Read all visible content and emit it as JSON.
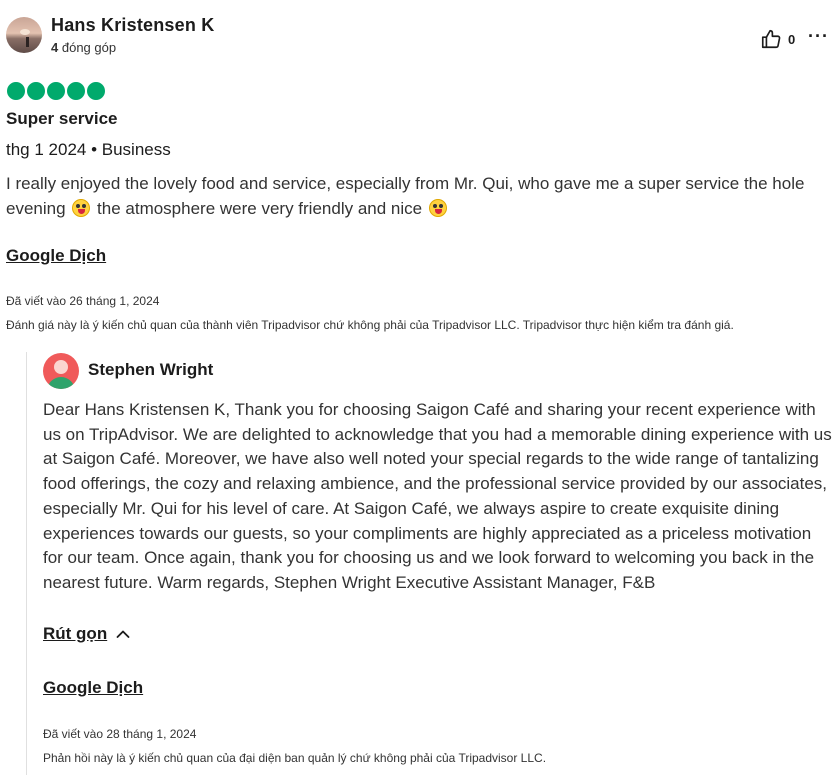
{
  "review": {
    "author_name": "Hans Kristensen K",
    "contributions_count": "4",
    "contributions_label": "đóng góp",
    "helpful_count": "0",
    "more_label": "···",
    "rating": 5,
    "rating_color": "#00aa6c",
    "title": "Super service",
    "visit_meta": "thg 1 2024 • Business",
    "body_part1": "I really enjoyed the lovely food and service, especially from Mr. Qui, who gave me a super service the hole evening",
    "body_part2": "the atmosphere were very friendly and nice",
    "emoji": "grinning-face-emoji",
    "translate_label": "Google Dịch",
    "written_date": "Đã viết vào 26 tháng 1, 2024",
    "disclaimer": "Đánh giá này là ý kiến chủ quan của thành viên Tripadvisor chứ không phải của Tripadvisor LLC. Tripadvisor thực hiện kiểm tra đánh giá."
  },
  "response": {
    "author_name": "Stephen Wright",
    "body": "Dear Hans Kristensen K, Thank you for choosing Saigon Café and sharing your recent experience with us on TripAdvisor. We are delighted to acknowledge that you had a memorable dining experience with us at Saigon Café. Moreover, we have also well noted your special regards to the wide range of tantalizing food offerings, the cozy and relaxing ambience, and the professional service provided by our associates, especially Mr. Qui for his level of care. At Saigon Café, we always aspire to create exquisite dining experiences towards our guests, so your compliments are highly appreciated as a priceless motivation for our team. Once again, thank you for choosing us and we look forward to welcoming you back in the nearest future. Warm regards, Stephen Wright Executive Assistant Manager, F&B",
    "collapse_label": "Rút gọn",
    "translate_label": "Google Dịch",
    "written_date": "Đã viết vào 28 tháng 1, 2024",
    "disclaimer": "Phản hồi này là ý kiến chủ quan của đại diện ban quản lý chứ không phải của Tripadvisor LLC."
  }
}
